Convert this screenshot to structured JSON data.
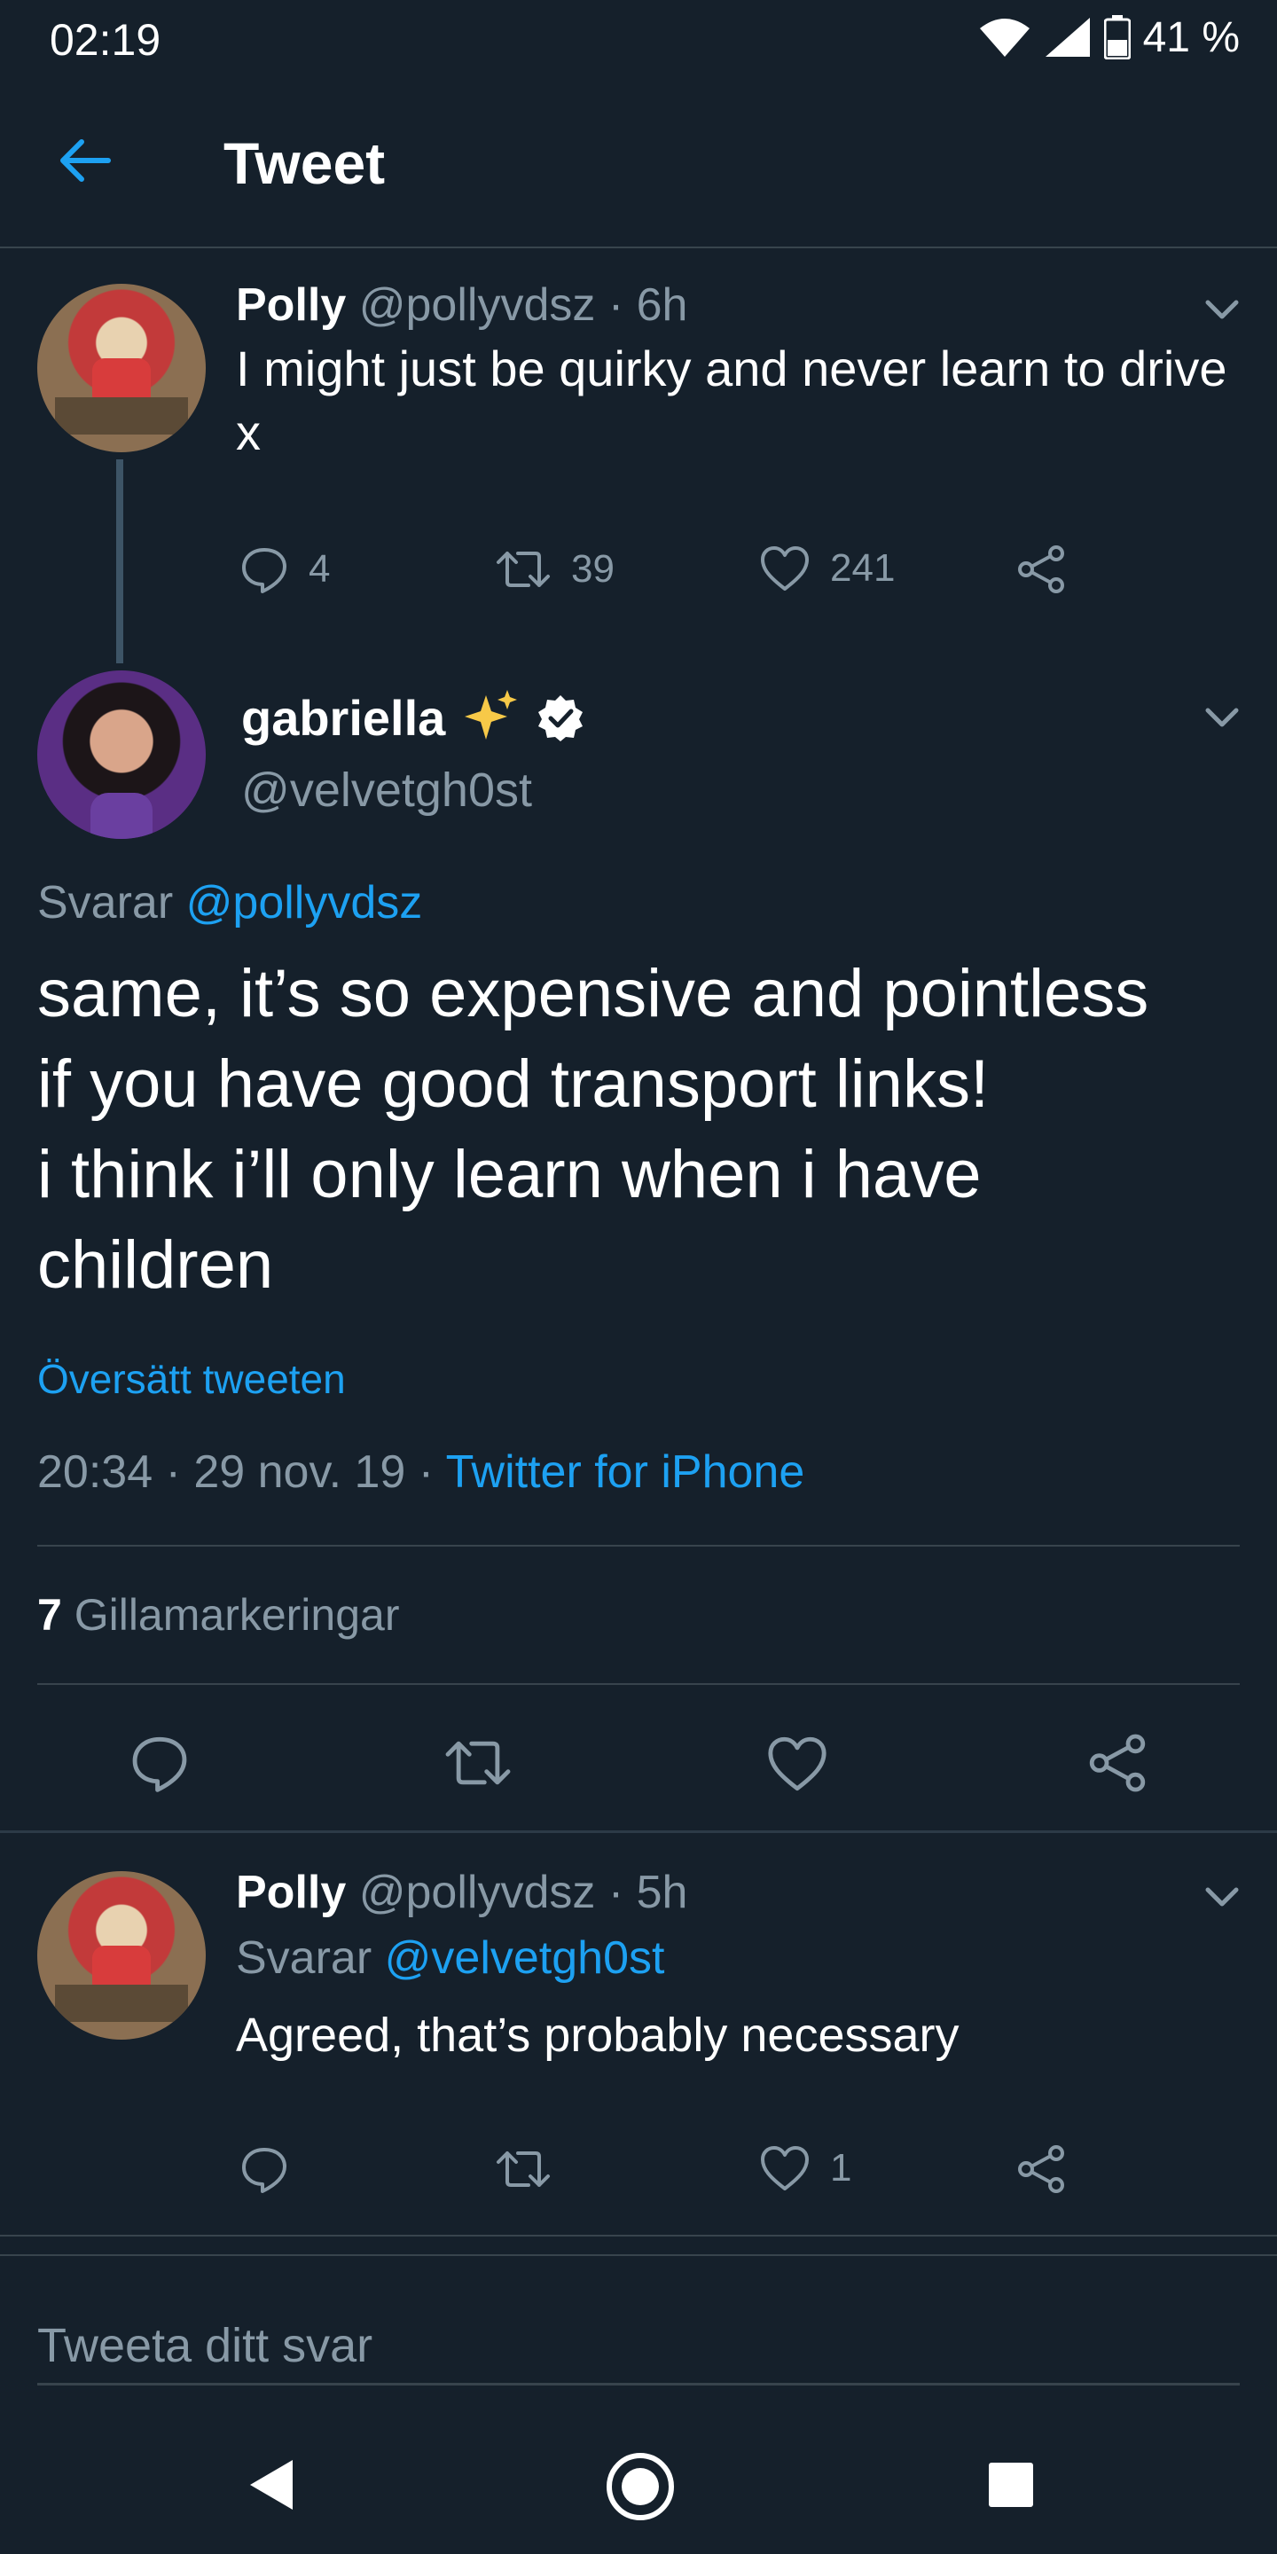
{
  "status_bar": {
    "time": "02:19",
    "battery": "41 %"
  },
  "header": {
    "title": "Tweet"
  },
  "parent_tweet": {
    "name": "Polly",
    "meta": "@pollyvdsz · 6h",
    "text_line1": "I might just be quirky and never learn to drive",
    "text_line2": "x",
    "reply_count": "4",
    "retweet_count": "39",
    "like_count": "241"
  },
  "main_tweet": {
    "name": "gabriella",
    "handle": "@velvetgh0st",
    "replying_label": "Svarar",
    "replying_to": "@pollyvdsz",
    "lines": [
      "same, it’s so expensive and pointless",
      "if you have good transport links!",
      "i think i’ll only learn when i have",
      "children"
    ],
    "translate": "Översätt tweeten",
    "timestamp": "20:34 · 29 nov. 19 ·",
    "source": "Twitter for iPhone",
    "likes_count": "7",
    "likes_label": "Gillamarkeringar"
  },
  "reply_tweet": {
    "name": "Polly",
    "meta": "@pollyvdsz · 5h",
    "replying_label": "Svarar",
    "replying_to": "@velvetgh0st",
    "text": "Agreed, that’s probably necessary",
    "like_count": "1"
  },
  "composer": {
    "placeholder": "Tweeta ditt svar"
  },
  "colors": {
    "background": "#15202b",
    "accent": "#1da1f2",
    "muted": "#8899a6",
    "divider": "#38444d"
  }
}
